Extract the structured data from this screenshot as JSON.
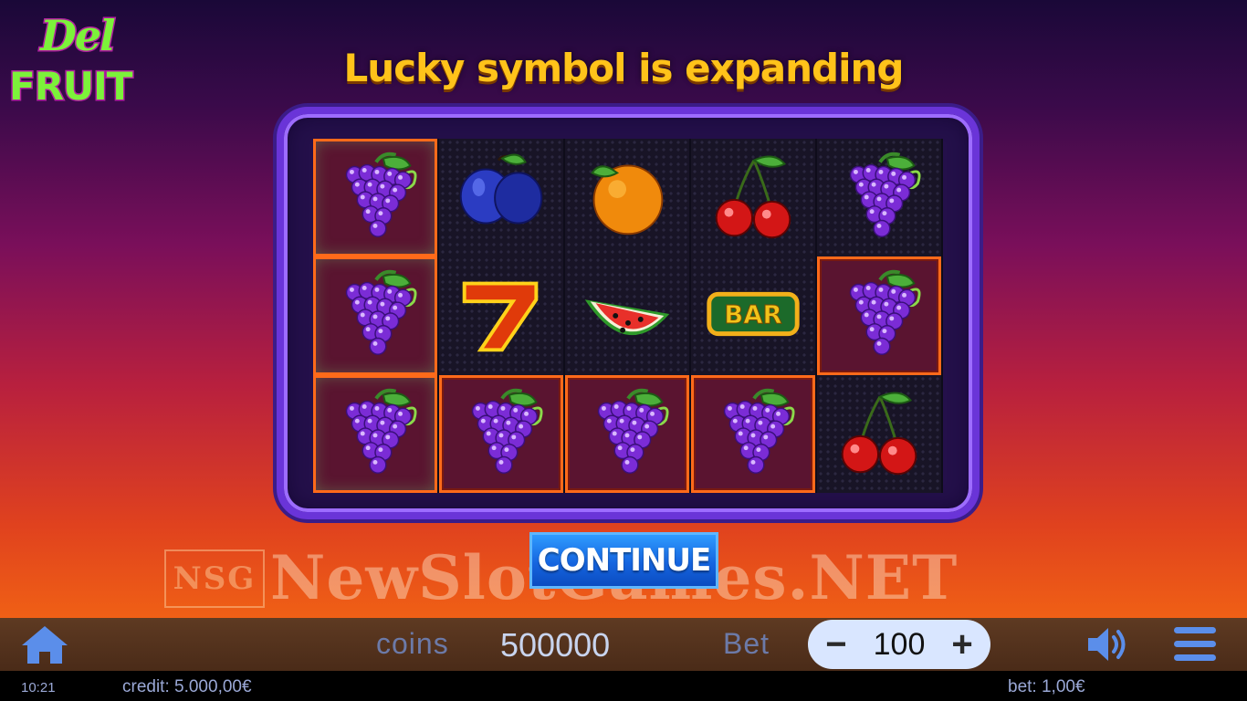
{
  "logo": {
    "line1": "Del",
    "line2": "FRUIT"
  },
  "title": "Lucky symbol is expanding",
  "reels": [
    [
      {
        "symbol": "grapes",
        "win": true
      },
      {
        "symbol": "plum",
        "win": false
      },
      {
        "symbol": "orange",
        "win": false
      },
      {
        "symbol": "cherry",
        "win": false
      },
      {
        "symbol": "grapes",
        "win": false
      }
    ],
    [
      {
        "symbol": "grapes",
        "win": true
      },
      {
        "symbol": "seven",
        "win": false
      },
      {
        "symbol": "watermelon",
        "win": false
      },
      {
        "symbol": "bar",
        "win": false
      },
      {
        "symbol": "grapes",
        "win": true
      }
    ],
    [
      {
        "symbol": "grapes",
        "win": true
      },
      {
        "symbol": "grapes",
        "win": true
      },
      {
        "symbol": "grapes",
        "win": true
      },
      {
        "symbol": "grapes",
        "win": true
      },
      {
        "symbol": "cherry",
        "win": false
      }
    ]
  ],
  "bar_symbol_text": "BAR",
  "continue_label": "CONTINUE",
  "watermark": {
    "box_text": "NSG",
    "text": "NewSlotGames.NET"
  },
  "bottom_bar": {
    "home_icon": "home-icon",
    "coins_label": "coins",
    "coins_value": "500000",
    "bet_label": "Bet",
    "bet_minus": "−",
    "bet_value": "100",
    "bet_plus": "+",
    "sound_icon": "speaker-icon",
    "menu_icon": "hamburger-menu-icon"
  },
  "status": {
    "clock": "10:21",
    "credit": "credit: 5.000,00€",
    "bet": "bet: 1,00€"
  },
  "colors": {
    "title": "#ffc31a",
    "win_border": "#ff6a1a",
    "continue": "#1565e0",
    "frame": "#6a34d8"
  }
}
